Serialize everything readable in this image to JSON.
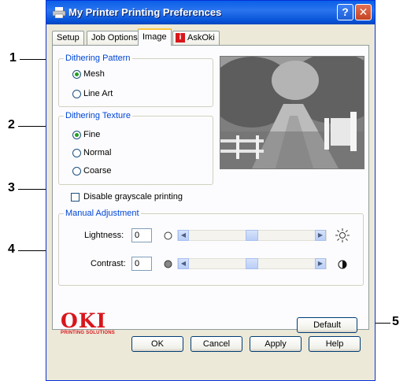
{
  "window": {
    "title": "My Printer Printing Preferences",
    "help_label": "?",
    "close_label": "✕"
  },
  "tabs": [
    {
      "label": "Setup"
    },
    {
      "label": "Job Options"
    },
    {
      "label": "Image"
    },
    {
      "label": "AskOki"
    }
  ],
  "dithering_pattern": {
    "legend": "Dithering Pattern",
    "options": [
      {
        "label": "Mesh",
        "selected": true
      },
      {
        "label": "Line Art",
        "selected": false
      }
    ]
  },
  "dithering_texture": {
    "legend": "Dithering Texture",
    "options": [
      {
        "label": "Fine",
        "selected": true
      },
      {
        "label": "Normal",
        "selected": false
      },
      {
        "label": "Coarse",
        "selected": false
      }
    ]
  },
  "grayscale": {
    "label": "Disable grayscale printing",
    "checked": false
  },
  "manual_adjustment": {
    "legend": "Manual Adjustment",
    "lightness": {
      "label": "Lightness:",
      "value": "0"
    },
    "contrast": {
      "label": "Contrast:",
      "value": "0"
    }
  },
  "logo": {
    "name": "OKI",
    "tagline": "PRINTING SOLUTIONS",
    "color": "#d8161c"
  },
  "buttons": {
    "default": "Default",
    "ok": "OK",
    "cancel": "Cancel",
    "apply": "Apply",
    "help": "Help"
  },
  "callouts": [
    "1",
    "2",
    "3",
    "4",
    "5"
  ],
  "colors": {
    "title_bar": "#0a5fe8",
    "legend_text": "#0046d5",
    "radio_dot": "#21a121"
  }
}
